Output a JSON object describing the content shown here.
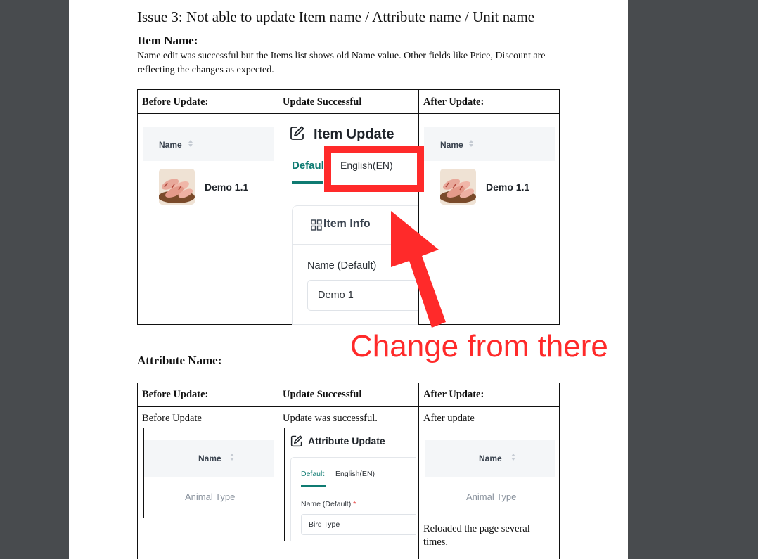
{
  "doc": {
    "issue_title": "Issue 3: Not able to update Item name / Attribute name / Unit name",
    "item_section": {
      "heading": "Item Name:",
      "description": "Name edit was successful but the Items list shows old Name value.  Other fields like Price, Discount are reflecting the changes as expected.",
      "table_headers": [
        "Before Update:",
        "Update Successful",
        "After Update:"
      ],
      "before": {
        "column": "Name",
        "item": "Demo 1.1"
      },
      "update": {
        "title": "Item Update",
        "tab_default": "Defaul",
        "tab_english": "English(EN)",
        "card_title": "Item Info",
        "field_label": "Name (Default)",
        "field_value": "Demo 1"
      },
      "after": {
        "column": "Name",
        "item": "Demo 1.1"
      }
    },
    "annotation": {
      "text": "Change from there",
      "color": "#ff2a2a"
    },
    "attribute_section": {
      "heading": "Attribute Name:",
      "table_headers": [
        "Before Update:",
        "Update Successful",
        "After Update:"
      ],
      "before": {
        "note": "Before Update",
        "column": "Name",
        "value": "Animal Type"
      },
      "update": {
        "note": "Update was successful.",
        "title": "Attribute Update",
        "tab_default": "Default",
        "tab_english": "English(EN)",
        "field_label": "Name (Default)",
        "required_mark": "*",
        "field_value": "Bird Type"
      },
      "after": {
        "note": "After update",
        "column": "Name",
        "value": "Animal Type",
        "footnote": "Reloaded the page several times."
      }
    },
    "colors": {
      "accent_teal": "#0f7b72",
      "page_bg": "#484b4e"
    }
  }
}
